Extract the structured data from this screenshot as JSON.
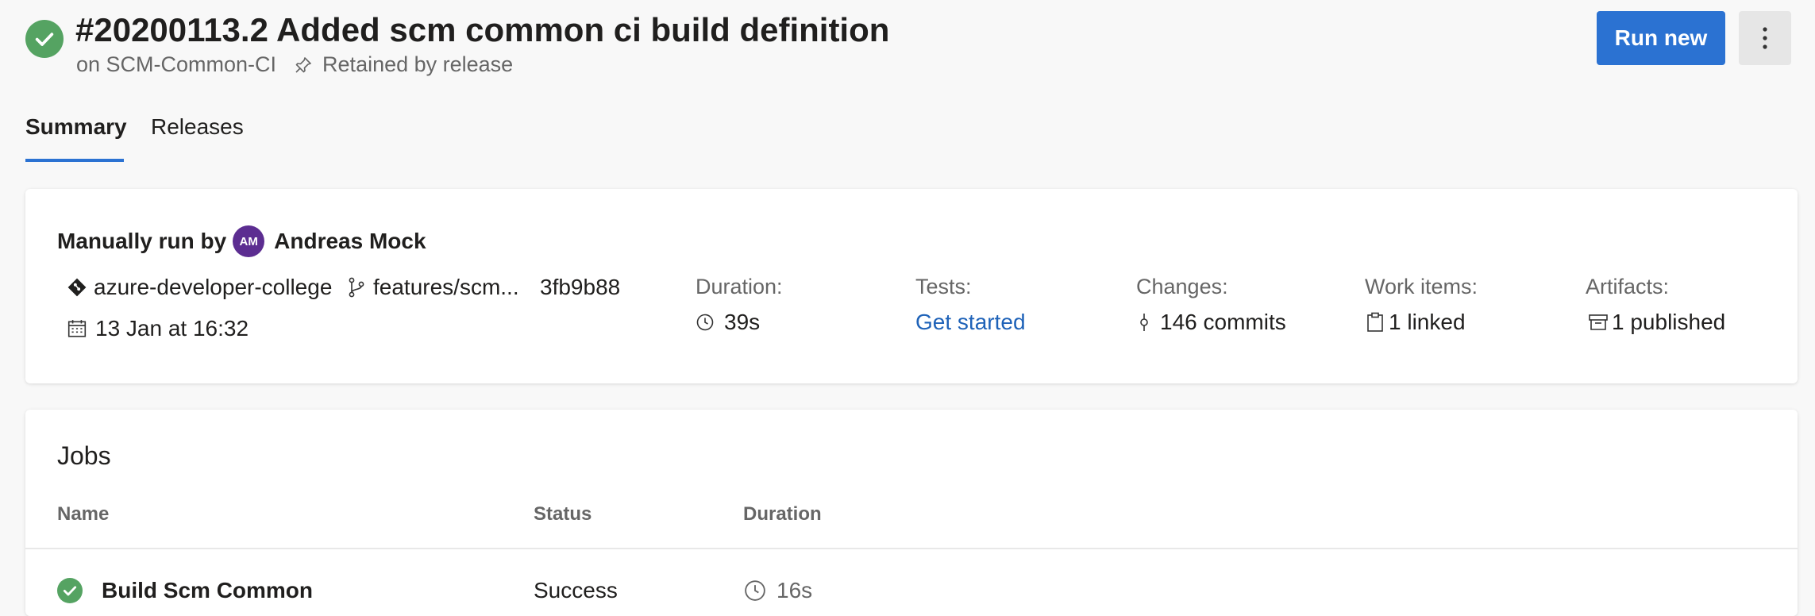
{
  "header": {
    "title": "#20200113.2 Added scm common ci build definition",
    "pipeline": "on SCM-Common-CI",
    "retention": "Retained by release",
    "run_new_label": "Run new",
    "status_color": "#55a362",
    "accent_color": "#2b72d2"
  },
  "tabs": [
    {
      "label": "Summary",
      "selected": true
    },
    {
      "label": "Releases",
      "selected": false
    }
  ],
  "summary": {
    "run_by_prefix": "Manually run by",
    "user_initials": "AM",
    "user_name": "Andreas Mock",
    "repo": "azure-developer-college",
    "branch": "features/scm...",
    "commit": "3fb9b88",
    "date": "13 Jan at 16:32",
    "duration": {
      "label": "Duration:",
      "value": "39s"
    },
    "tests": {
      "label": "Tests:",
      "value": "Get started"
    },
    "changes": {
      "label": "Changes:",
      "value": "146 commits"
    },
    "work_items": {
      "label": "Work items:",
      "value": "1 linked"
    },
    "artifacts": {
      "label": "Artifacts:",
      "value": "1 published"
    }
  },
  "jobs": {
    "title": "Jobs",
    "columns": [
      "Name",
      "Status",
      "Duration"
    ],
    "rows": [
      {
        "name": "Build Scm Common",
        "status": "Success",
        "duration": "16s"
      }
    ]
  }
}
